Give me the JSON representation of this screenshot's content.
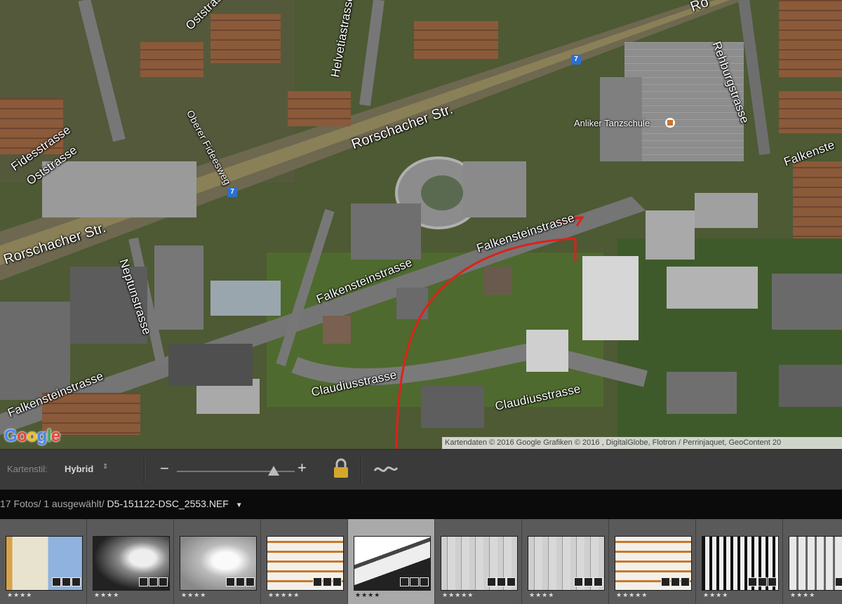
{
  "map": {
    "street_labels": [
      {
        "name": "oststrasse-top",
        "text": "Oststrasse"
      },
      {
        "name": "helvetiastrasse",
        "text": "Helvetiastrasse"
      },
      {
        "name": "rehburgstrasse",
        "text": "Rehburgstrasse"
      },
      {
        "name": "oberer-fideesweg",
        "text": "Oberer Fideesweg"
      },
      {
        "name": "fidesstrasse",
        "text": "Fidesstrasse"
      },
      {
        "name": "oststrasse-left",
        "text": "Oststrasse"
      },
      {
        "name": "rorschacher-str-mid",
        "text": "Rorschacher Str."
      },
      {
        "name": "rorschacher-str-left",
        "text": "Rorschacher Str."
      },
      {
        "name": "neptunstrasse",
        "text": "Neptunstrasse"
      },
      {
        "name": "falkensteinstrasse-east",
        "text": "Falkensteinstrasse"
      },
      {
        "name": "falkensteinstrasse-mid",
        "text": "Falkensteinstrasse"
      },
      {
        "name": "falkensteinstrasse-left",
        "text": "Falkensteinstrasse"
      },
      {
        "name": "falkensteinstrasse-right",
        "text": "Falkenste"
      },
      {
        "name": "claudiusstrasse-mid",
        "text": "Claudiusstrasse"
      },
      {
        "name": "claudiusstrasse-right",
        "text": "Claudiusstrasse"
      },
      {
        "name": "rorschacher-top",
        "text": "Ro"
      }
    ],
    "poi_label": "Anliker Tanzschule",
    "route_number": "7",
    "google_logo": "Google",
    "attribution": "Kartendaten © 2016 Google Grafiken © 2016 , DigitalGlobe, Flotron / Perrinjaquet, GeoContent  20",
    "annotation_color": "#e0201a"
  },
  "toolbar": {
    "style_label": "Kartenstil:",
    "style_value": "Hybrid",
    "zoom_minus": "−",
    "zoom_plus": "+",
    "zoom_level": 0.82,
    "lock_icon": "padlock-icon",
    "track_icon": "track-icon"
  },
  "filmstrip": {
    "count_text": "17 Fotos/ 1 ausgewählt/ ",
    "filename": "D5-151122-DSC_2553.NEF",
    "dropdown_icon": "dropdown-triangle-icon",
    "items": [
      {
        "stars": "★★★★",
        "selected": false,
        "style": "yellow-blue"
      },
      {
        "stars": "★★★★",
        "selected": false,
        "style": "statue-dark"
      },
      {
        "stars": "★★★★",
        "selected": false,
        "style": "statue-light"
      },
      {
        "stars": "★★★★★",
        "selected": false,
        "style": "orange-bands"
      },
      {
        "stars": "★★★★",
        "selected": true,
        "style": "bw-curve"
      },
      {
        "stars": "★★★★★",
        "selected": false,
        "style": "gray-lines"
      },
      {
        "stars": "★★★★",
        "selected": false,
        "style": "gray-lines"
      },
      {
        "stars": "★★★★★",
        "selected": false,
        "style": "orange-bands"
      },
      {
        "stars": "★★★★",
        "selected": false,
        "style": "bw-bands"
      },
      {
        "stars": "★★★★",
        "selected": false,
        "style": "gray-bars"
      }
    ]
  }
}
